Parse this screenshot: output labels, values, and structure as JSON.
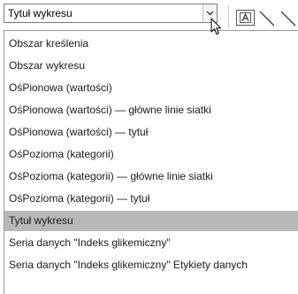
{
  "combo": {
    "value": "Tytuł wykresu"
  },
  "icons": {
    "dropdown_arrow": "chevron-down-icon",
    "cursor": "mouse-pointer-icon",
    "format_selection": "format-selection-icon",
    "line_tool": "line-icon"
  },
  "dropdown": {
    "selected_index": 9,
    "items": [
      {
        "label": "Obszar kreślenia"
      },
      {
        "label": "Obszar wykresu"
      },
      {
        "label": "OśPionowa (wartości)"
      },
      {
        "label": "OśPionowa (wartości)  — główne linie siatki"
      },
      {
        "label": "OśPionowa (wartości)  — tytuł"
      },
      {
        "label": "OśPozioma (kategorii)"
      },
      {
        "label": "OśPozioma (kategorii)  — główne linie siatki"
      },
      {
        "label": "OśPozioma (kategorii)  — tytuł"
      },
      {
        "label": "Tytuł wykresu"
      },
      {
        "label": "Seria danych \"Indeks glikemiczny\""
      },
      {
        "label": "Seria danych \"Indeks glikemiczny\" Etykiety danych"
      }
    ]
  },
  "colors": {
    "selected_item_bg": "#b8b8b8",
    "border": "#7a7a7a"
  }
}
